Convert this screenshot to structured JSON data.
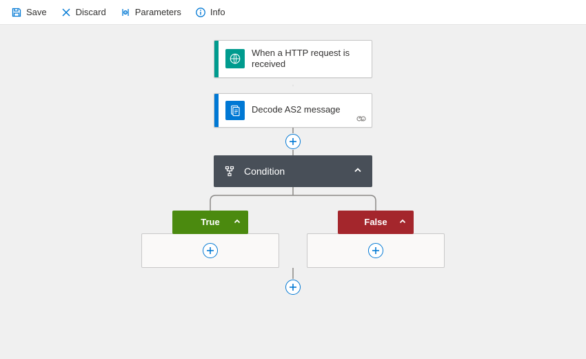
{
  "toolbar": {
    "save": "Save",
    "discard": "Discard",
    "parameters": "Parameters",
    "info": "Info"
  },
  "colors": {
    "toolbar_icon": "#0078d4",
    "http_accent": "#009b8e",
    "as2_accent": "#0078d4",
    "condition_bg": "#484f58",
    "true": "#4b8a0f",
    "false": "#a4262c",
    "connector": "#8a8886"
  },
  "steps": {
    "http": {
      "title": "When a HTTP request is received"
    },
    "decode": {
      "title": "Decode AS2 message"
    },
    "condition": {
      "title": "Condition"
    }
  },
  "branches": {
    "true": {
      "label": "True"
    },
    "false": {
      "label": "False"
    }
  }
}
